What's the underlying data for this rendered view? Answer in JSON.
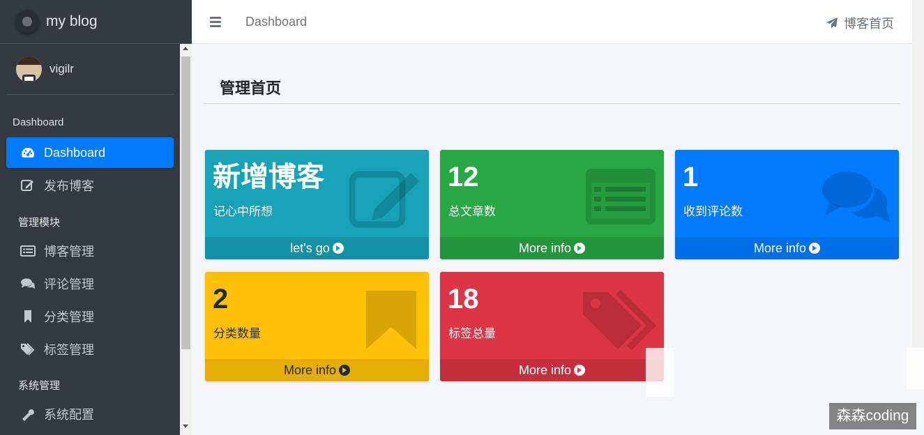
{
  "brand": {
    "name": "my blog"
  },
  "user": {
    "name": "vigilr"
  },
  "sidebar": {
    "sections": [
      {
        "header": "Dashboard"
      },
      {
        "header": "管理模块"
      },
      {
        "header": "系统管理"
      }
    ],
    "items": [
      {
        "label": "Dashboard",
        "icon": "dashboard-icon",
        "active": true
      },
      {
        "label": "发布博客",
        "icon": "edit-icon"
      },
      {
        "label": "博客管理",
        "icon": "list-icon"
      },
      {
        "label": "评论管理",
        "icon": "comments-icon"
      },
      {
        "label": "分类管理",
        "icon": "bookmark-icon"
      },
      {
        "label": "标签管理",
        "icon": "tags-icon"
      },
      {
        "label": "系统配置",
        "icon": "wrench-icon"
      }
    ]
  },
  "topbar": {
    "breadcrumb": "Dashboard",
    "home_link": "博客首页"
  },
  "main": {
    "title": "管理首页",
    "cards": [
      {
        "value": "新增博客",
        "label": "记心中所想",
        "footer": "let's go",
        "color": "#17a2b8",
        "icon": "edit-icon"
      },
      {
        "value": "12",
        "label": "总文章数",
        "footer": "More info",
        "color": "#28a745",
        "icon": "list-icon"
      },
      {
        "value": "1",
        "label": "收到评论数",
        "footer": "More info",
        "color": "#007bff",
        "icon": "comments-icon"
      },
      {
        "value": "2",
        "label": "分类数量",
        "footer": "More info",
        "color": "#ffc107",
        "icon": "bookmark-icon"
      },
      {
        "value": "18",
        "label": "标签总量",
        "footer": "More info",
        "color": "#dc3545",
        "icon": "tags-icon"
      }
    ]
  },
  "watermark": "森森coding"
}
